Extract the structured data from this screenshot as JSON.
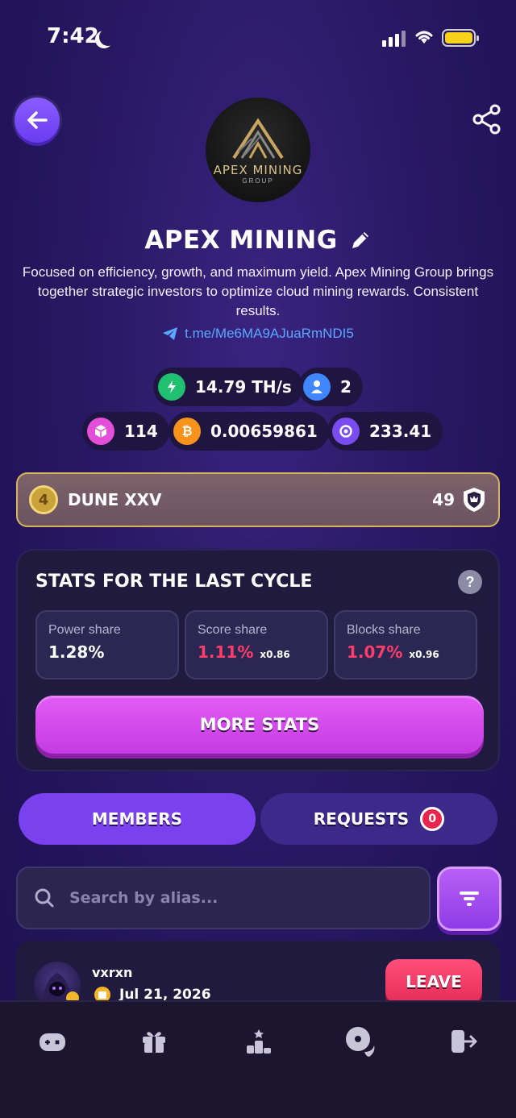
{
  "status_bar": {
    "time": "7:42"
  },
  "logo": {
    "name": "APEX MINING",
    "subtitle": "GROUP"
  },
  "team": {
    "name": "APEX MINING",
    "description": "Focused on efficiency, growth, and maximum yield. Apex Mining Group brings together strategic investors to optimize cloud mining rewards. Consistent results.",
    "link": "t.me/Me6MA9AJuaRmNDI5"
  },
  "metrics": {
    "hashrate": "14.79 TH/s",
    "members": "2",
    "blocks": "114",
    "btc": "0.00659861",
    "score": "233.41"
  },
  "league": {
    "level": "4",
    "name": "DUNE XXV",
    "rank": "49"
  },
  "stats": {
    "title": "STATS FOR THE LAST CYCLE",
    "power": {
      "label": "Power share",
      "value": "1.28%"
    },
    "score": {
      "label": "Score share",
      "value": "1.11%",
      "mult": "x0.86"
    },
    "blocks": {
      "label": "Blocks share",
      "value": "1.07%",
      "mult": "x0.96"
    },
    "more_label": "MORE STATS"
  },
  "tabs": {
    "members": "MEMBERS",
    "requests": "REQUESTS",
    "requests_count": "0"
  },
  "search": {
    "placeholder": "Search by alias..."
  },
  "member": {
    "alias": "vxrxn",
    "date": "Jul 21, 2026",
    "leave_label": "LEAVE"
  },
  "colors": {
    "accent": "#7a42ee",
    "pink": "#e35cf7",
    "danger": "#ff3d6a",
    "link": "#5aa7ff"
  }
}
